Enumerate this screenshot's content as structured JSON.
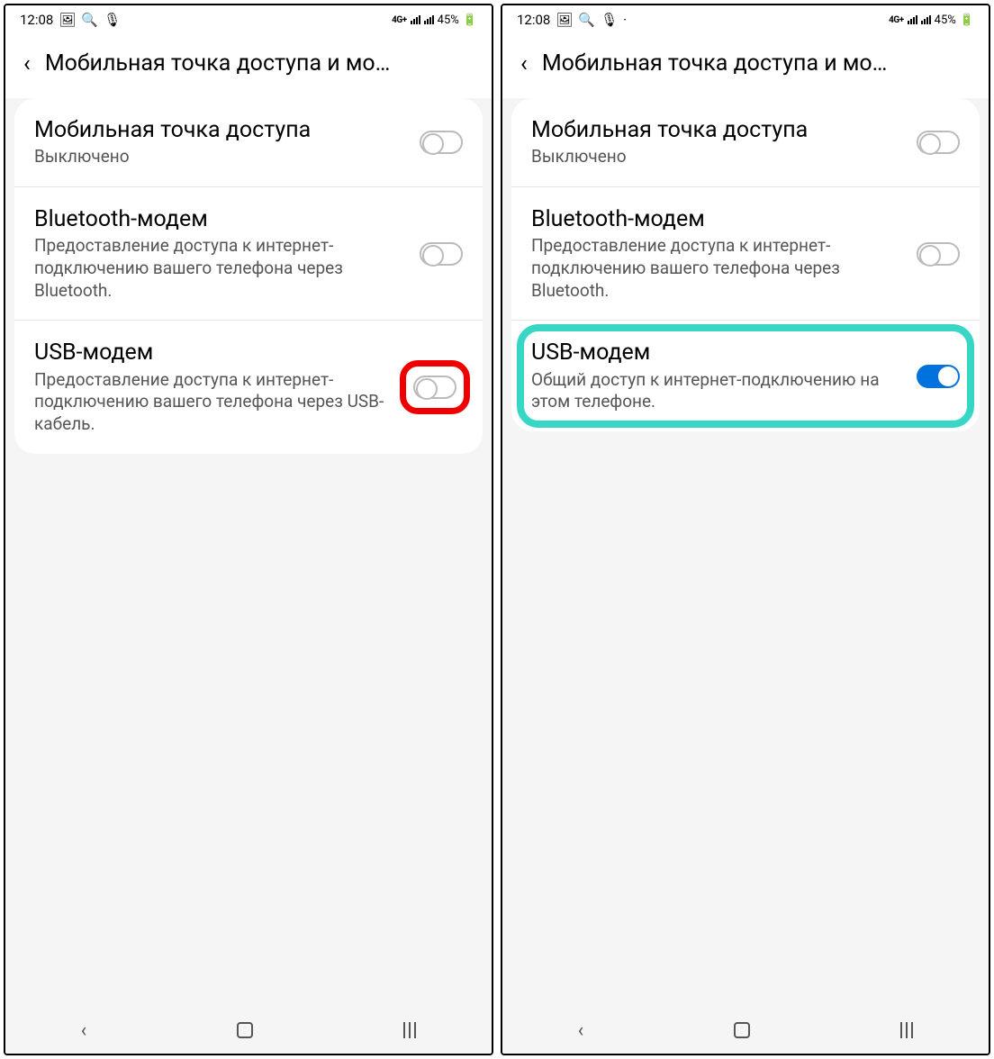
{
  "statusbar": {
    "time": "12:08",
    "network_label": "4G+",
    "battery": "45%"
  },
  "header": {
    "title": "Мобильная точка доступа и мо…"
  },
  "left": {
    "hotspot_title": "Мобильная точка доступа",
    "hotspot_sub": "Выключено",
    "bt_title": "Bluetooth-модем",
    "bt_sub": "Предоставление доступа к интернет-подключению вашего телефона через Bluetooth.",
    "usb_title": "USB-модем",
    "usb_sub": "Предоставление доступа к интернет-подключению вашего телефона через USB-кабель."
  },
  "right": {
    "hotspot_title": "Мобильная точка доступа",
    "hotspot_sub": "Выключено",
    "bt_title": "Bluetooth-модем",
    "bt_sub": "Предоставление доступа к интернет-подключению вашего телефона через Bluetooth.",
    "usb_title": "USB-модем",
    "usb_sub": "Общий доступ к интернет-подключению на этом телефоне."
  },
  "highlight_colors": {
    "red": "#ee0000",
    "teal": "#38d6c5"
  }
}
